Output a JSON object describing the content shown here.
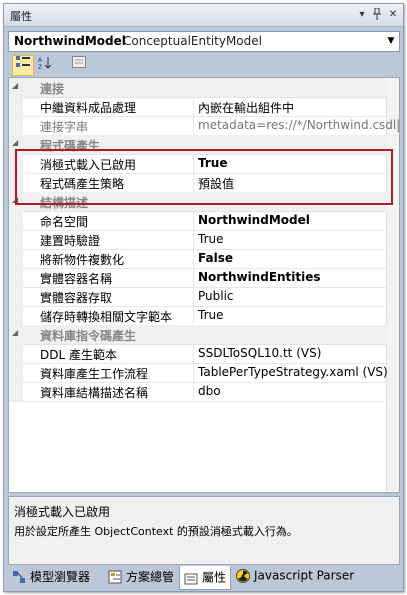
{
  "window": {
    "title": "屬性"
  },
  "object_selector": {
    "name": "NorthwindModel",
    "type": "ConceptualEntityModel"
  },
  "categories": [
    {
      "label": "連接",
      "rows": [
        {
          "name": "中繼資料成品處理",
          "value": "內嵌在輸出組件中",
          "muted": false,
          "bold": false
        },
        {
          "name": "連接字串",
          "value": "metadata=res://*/Northwind.csdl|re",
          "muted": true,
          "bold": false
        }
      ]
    },
    {
      "label": "程式碼產生",
      "rows": [
        {
          "name": "消極式載入已啟用",
          "value": "True",
          "muted": false,
          "bold": true,
          "selected": true
        },
        {
          "name": "程式碼產生策略",
          "value": "預設值",
          "muted": false,
          "bold": false
        }
      ]
    },
    {
      "label": "結構描述",
      "rows": [
        {
          "name": "命名空間",
          "value": "NorthwindModel",
          "muted": false,
          "bold": true
        },
        {
          "name": "建置時驗證",
          "value": "True",
          "muted": false,
          "bold": false
        },
        {
          "name": "將新物件複數化",
          "value": "False",
          "muted": false,
          "bold": true
        },
        {
          "name": "實體容器名稱",
          "value": "NorthwindEntities",
          "muted": false,
          "bold": true
        },
        {
          "name": "實體容器存取",
          "value": "Public",
          "muted": false,
          "bold": false
        },
        {
          "name": "儲存時轉換相關文字範本",
          "value": "True",
          "muted": false,
          "bold": false
        }
      ]
    },
    {
      "label": "資料庫指令碼產生",
      "rows": [
        {
          "name": "DDL 產生範本",
          "value": "SSDLToSQL10.tt (VS)",
          "muted": false,
          "bold": false
        },
        {
          "name": "資料庫產生工作流程",
          "value": "TablePerTypeStrategy.xaml (VS)",
          "muted": false,
          "bold": false
        },
        {
          "name": "資料庫結構描述名稱",
          "value": "dbo",
          "muted": false,
          "bold": false
        }
      ]
    }
  ],
  "description": {
    "title": "消極式載入已啟用",
    "text": "用於設定所產生 ObjectContext 的預設消極式載入行為。"
  },
  "tabs": [
    {
      "label": "模型瀏覽器",
      "active": false
    },
    {
      "label": "方案總管",
      "active": false
    },
    {
      "label": "屬性",
      "active": true
    },
    {
      "label": "Javascript Parser",
      "active": false
    }
  ],
  "colors": {
    "highlight": "#b01b25",
    "frame": "#bcc7d8",
    "category_text": "#888888"
  }
}
